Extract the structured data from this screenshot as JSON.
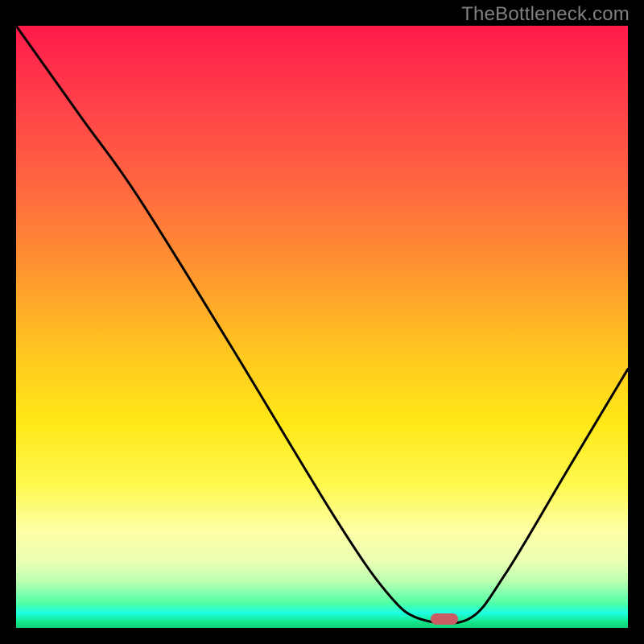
{
  "watermark": "TheBottleneck.com",
  "chart_data": {
    "type": "line",
    "title": "",
    "xlabel": "",
    "ylabel": "",
    "x_range_fraction": [
      0,
      1
    ],
    "y_range_fraction": [
      0,
      1
    ],
    "note": "Axes are unlabeled; values are fractional positions across the 760×748 plot area. y_frac=0 is the top edge, y_frac≈1 is the bottom (green) edge.",
    "series": [
      {
        "name": "curve",
        "points": [
          {
            "x_frac": 0.0,
            "y_frac": 0.0
          },
          {
            "x_frac": 0.105,
            "y_frac": 0.15
          },
          {
            "x_frac": 0.2,
            "y_frac": 0.285
          },
          {
            "x_frac": 0.35,
            "y_frac": 0.53
          },
          {
            "x_frac": 0.52,
            "y_frac": 0.815
          },
          {
            "x_frac": 0.605,
            "y_frac": 0.94
          },
          {
            "x_frac": 0.66,
            "y_frac": 0.985
          },
          {
            "x_frac": 0.74,
            "y_frac": 0.985
          },
          {
            "x_frac": 0.8,
            "y_frac": 0.91
          },
          {
            "x_frac": 0.9,
            "y_frac": 0.74
          },
          {
            "x_frac": 1.0,
            "y_frac": 0.57
          }
        ]
      }
    ],
    "marker": {
      "name": "highlight-pill",
      "x_frac": 0.7,
      "y_frac": 0.985,
      "color": "#cc5c63"
    },
    "background": "red-to-green vertical gradient (red top, green bottom)"
  }
}
